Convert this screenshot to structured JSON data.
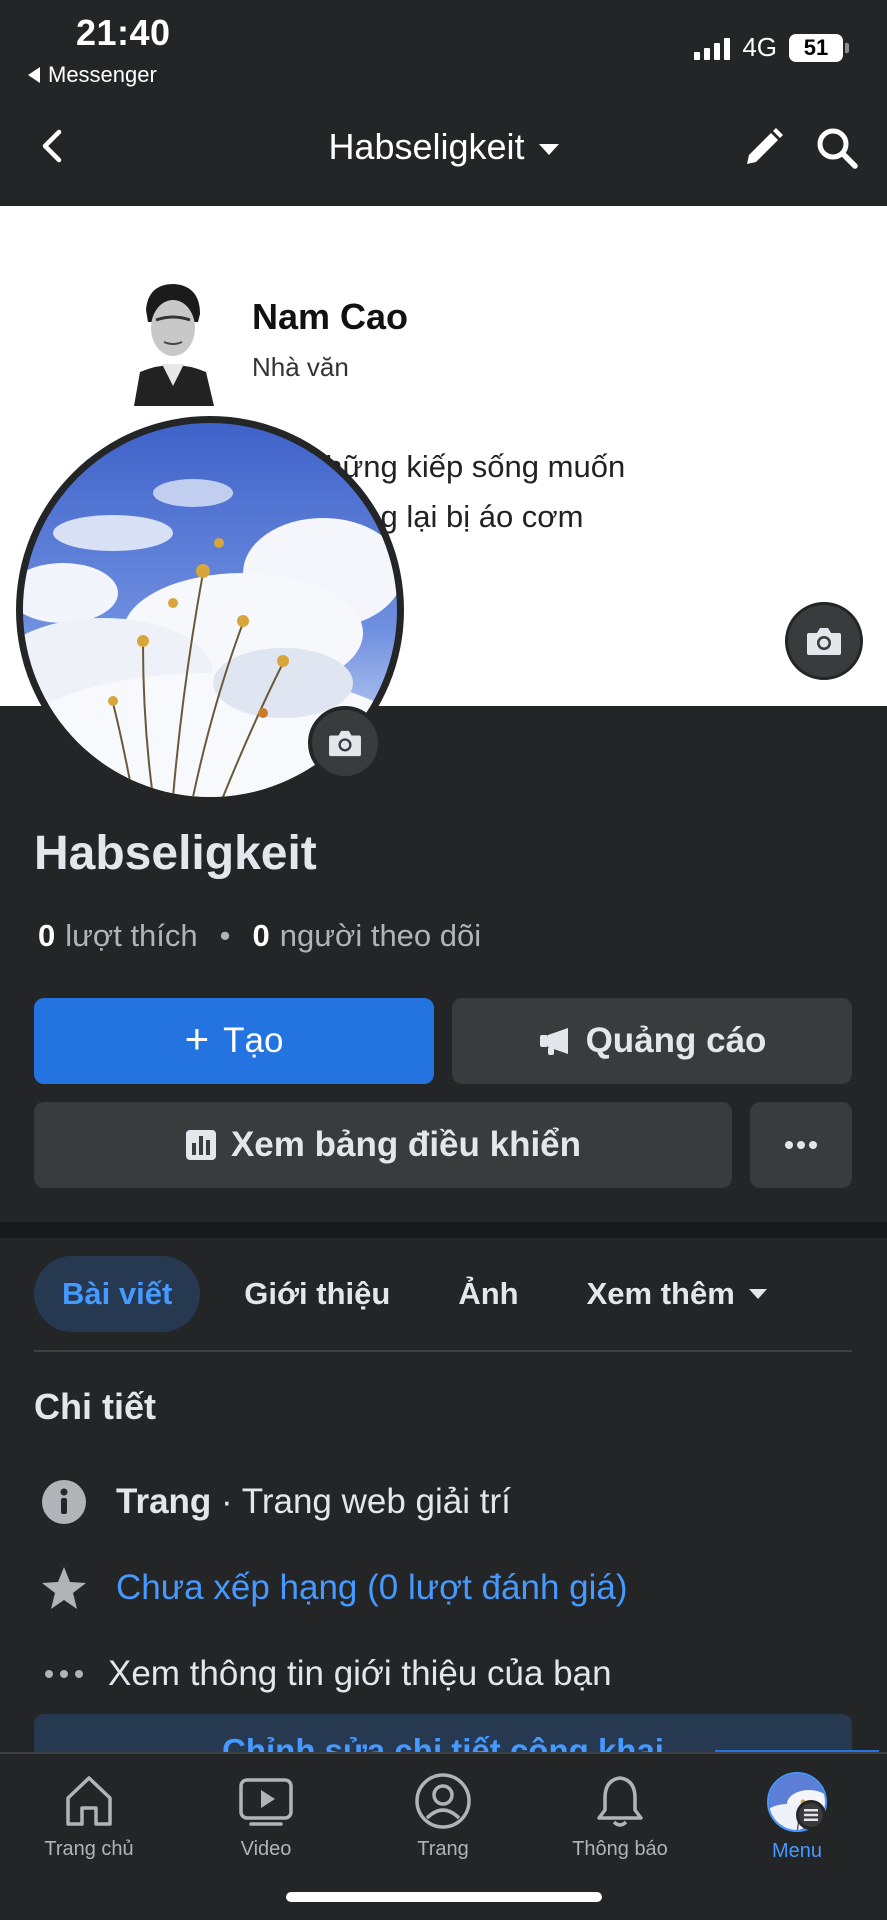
{
  "status": {
    "time": "21:40",
    "back_app": "Messenger",
    "network": "4G",
    "battery": "51"
  },
  "nav": {
    "title": "Habseligkeit"
  },
  "cover": {
    "person_name": "Nam Cao",
    "person_role": "Nhà văn",
    "quote_line1": "những kiếp sống muốn",
    "quote_line2": "nhưng lại bị áo cơm"
  },
  "profile": {
    "name": "Habseligkeit",
    "likes_count": "0",
    "likes_label": "lượt thích",
    "followers_count": "0",
    "followers_label": "người theo dõi"
  },
  "actions": {
    "create_label": "Tạo",
    "ads_label": "Quảng cáo",
    "dashboard_label": "Xem bảng điều khiển"
  },
  "tabs": [
    {
      "label": "Bài viết",
      "active": true
    },
    {
      "label": "Giới thiệu"
    },
    {
      "label": "Ảnh"
    },
    {
      "label": "Xem thêm"
    }
  ],
  "details": {
    "title": "Chi tiết",
    "category_bold": "Trang",
    "category_rest": " · Trang web giải trí",
    "rating": "Chưa xếp hạng (0 lượt đánh giá)",
    "about": "Xem thông tin giới thiệu của bạn",
    "edit_public": "Chỉnh sửa chi tiết công khai"
  },
  "bottom_nav": [
    {
      "label": "Trang chủ",
      "icon": "home-icon"
    },
    {
      "label": "Video",
      "icon": "video-icon"
    },
    {
      "label": "Trang",
      "icon": "page-icon"
    },
    {
      "label": "Thông báo",
      "icon": "bell-icon"
    },
    {
      "label": "Menu",
      "icon": "menu-avatar",
      "active": true
    }
  ],
  "colors": {
    "background": "#242526",
    "accent": "#2374e1",
    "link": "#4599ff"
  }
}
